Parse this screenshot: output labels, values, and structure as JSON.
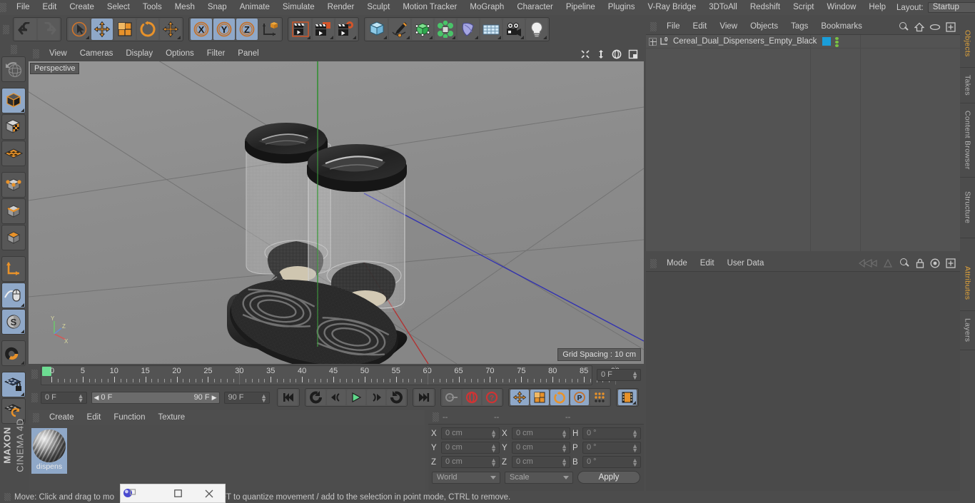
{
  "app": {
    "name": "MAXON CINEMA 4D",
    "brand_line1": "MAXON",
    "brand_line2": "CINEMA 4D"
  },
  "top_menu": {
    "items": [
      "File",
      "Edit",
      "Create",
      "Select",
      "Tools",
      "Mesh",
      "Snap",
      "Animate",
      "Simulate",
      "Render",
      "Sculpt",
      "Motion Tracker",
      "MoGraph",
      "Character",
      "Pipeline",
      "Plugins",
      "V-Ray Bridge",
      "3DToAll",
      "Redshift",
      "Script",
      "Window",
      "Help"
    ],
    "layout_label": "Layout:",
    "layout_value": "Startup",
    "search_icon": "search-icon"
  },
  "toolbar": {
    "groups": [
      {
        "name": "history",
        "buttons": [
          {
            "name": "undo-button",
            "icon": "undo-icon",
            "selected": false
          },
          {
            "name": "redo-button",
            "icon": "redo-icon",
            "selected": false
          }
        ]
      },
      {
        "name": "transform-tools",
        "buttons": [
          {
            "name": "live-selection-tool",
            "icon": "cursor-select-icon",
            "selected": false
          },
          {
            "name": "move-tool",
            "icon": "move-icon",
            "selected": true
          },
          {
            "name": "scale-tool",
            "icon": "scale-icon",
            "selected": false
          },
          {
            "name": "rotate-tool",
            "icon": "rotate-icon",
            "selected": false
          },
          {
            "name": "modeling-axis-tool",
            "icon": "move-icon",
            "selected": false
          }
        ]
      },
      {
        "name": "axis-locks",
        "buttons": [
          {
            "name": "lock-x-axis",
            "icon": "x-axis-icon",
            "label": "X",
            "selected": true
          },
          {
            "name": "lock-y-axis",
            "icon": "y-axis-icon",
            "label": "Y",
            "selected": true
          },
          {
            "name": "lock-z-axis",
            "icon": "z-axis-icon",
            "label": "Z",
            "selected": true
          },
          {
            "name": "world-object-coord-toggle",
            "icon": "world-coord-icon",
            "selected": false
          }
        ]
      },
      {
        "name": "render-tools",
        "buttons": [
          {
            "name": "render-view-button",
            "icon": "render-view-icon",
            "selected": false
          },
          {
            "name": "render-to-picture-viewer-button",
            "icon": "render-picture-icon",
            "selected": false
          },
          {
            "name": "render-settings-button",
            "icon": "render-settings-icon",
            "selected": false
          }
        ]
      },
      {
        "name": "create-objects",
        "buttons": [
          {
            "name": "add-cube-object",
            "icon": "cube-icon",
            "selected": false
          },
          {
            "name": "add-spline-object",
            "icon": "pen-spline-icon",
            "selected": false
          },
          {
            "name": "add-generator-object",
            "icon": "generator-cube-icon",
            "selected": false
          },
          {
            "name": "add-mograph-object",
            "icon": "mograph-cluster-icon",
            "selected": false
          },
          {
            "name": "add-deformer-object",
            "icon": "bend-deformer-icon",
            "selected": false
          },
          {
            "name": "add-environment-object",
            "icon": "floor-grid-icon",
            "selected": false
          },
          {
            "name": "add-camera-object",
            "icon": "camera-icon",
            "selected": false
          },
          {
            "name": "add-light-object",
            "icon": "light-bulb-icon",
            "selected": false
          }
        ]
      }
    ]
  },
  "left_toolbar": {
    "buttons": [
      {
        "name": "undo-view-button",
        "icon": "globe-undo-icon",
        "selected": false
      },
      {
        "name": "make-editable-button",
        "icon": "editable-cube-icon",
        "selected": true
      },
      {
        "name": "texture-axis-mode",
        "icon": "texture-cube-icon",
        "selected": false
      },
      {
        "name": "viewport-solo-mode",
        "icon": "grid-plane-icon",
        "selected": false
      },
      {
        "name": "point-mode",
        "icon": "point-mode-icon",
        "selected": false
      },
      {
        "name": "edge-mode",
        "icon": "edge-mode-icon",
        "selected": false
      },
      {
        "name": "polygon-mode",
        "icon": "polygon-mode-icon",
        "selected": false
      },
      {
        "name": "axis-modification",
        "icon": "axis-l-icon",
        "selected": false
      },
      {
        "name": "enable-snapping",
        "icon": "snap-mouse-icon",
        "selected": true
      },
      {
        "name": "workplane-mode",
        "icon": "workplane-s-icon",
        "selected": true
      },
      {
        "name": "magnet-tool",
        "icon": "magnet-icon",
        "selected": false
      },
      {
        "name": "lock-workplane",
        "icon": "workplane-lock-icon",
        "selected": true
      },
      {
        "name": "planar-workplane",
        "icon": "workplane-rotate-icon",
        "selected": false
      }
    ]
  },
  "viewport": {
    "menu_items": [
      "View",
      "Cameras",
      "Display",
      "Options",
      "Filter",
      "Panel"
    ],
    "label": "Perspective",
    "grid_spacing": "Grid Spacing : 10 cm",
    "axis_labels": {
      "x": "X",
      "y": "Y",
      "z": "Z"
    },
    "nav_icons": [
      "pan-icon",
      "dolly-icon",
      "orbit-icon",
      "maximize-view-icon"
    ]
  },
  "timeline": {
    "tick_labels": [
      "0",
      "5",
      "10",
      "15",
      "20",
      "25",
      "30",
      "35",
      "40",
      "45",
      "50",
      "55",
      "60",
      "65",
      "70",
      "75",
      "80",
      "85",
      "90"
    ],
    "tick_values": [
      0,
      5,
      10,
      15,
      20,
      25,
      30,
      35,
      40,
      45,
      50,
      55,
      60,
      65,
      70,
      75,
      80,
      85,
      90
    ],
    "range_start": 0,
    "range_end": 90,
    "current_frame_field": "0 F",
    "current_frame_small": "0 F",
    "preview_min": "0 F",
    "preview_max": "90 F",
    "max_frame_field": "90 F",
    "transport": [
      {
        "name": "go-to-start-button",
        "icon": "go-to-start-icon"
      },
      {
        "name": "play-backwards-loop-button",
        "icon": "loop-back-icon"
      },
      {
        "name": "previous-frame-button",
        "icon": "previous-frame-icon"
      },
      {
        "name": "play-forward-button",
        "icon": "play-icon"
      },
      {
        "name": "next-frame-button",
        "icon": "next-frame-icon"
      },
      {
        "name": "play-forward-loop-button",
        "icon": "loop-forward-icon"
      },
      {
        "name": "go-to-end-button",
        "icon": "go-to-end-icon"
      }
    ],
    "record_tools": [
      {
        "name": "autokeying-button",
        "icon": "key-icon",
        "selected": false
      },
      {
        "name": "record-active-objects-button",
        "icon": "record-icon",
        "selected": false
      },
      {
        "name": "keyframe-selection-button",
        "icon": "question-key-icon",
        "selected": false
      }
    ],
    "param_tools": [
      {
        "name": "record-position-button",
        "icon": "move-icon",
        "selected": true
      },
      {
        "name": "record-scale-button",
        "icon": "scale-icon",
        "selected": true
      },
      {
        "name": "record-rotation-button",
        "icon": "rotate-icon",
        "selected": true
      },
      {
        "name": "record-pla-button",
        "icon": "pla-icon",
        "selected": true
      },
      {
        "name": "record-points-button",
        "icon": "point-level-icon",
        "selected": false
      },
      {
        "name": "timeline-mode-button",
        "icon": "filmstrip-icon",
        "selected": true
      }
    ]
  },
  "material_manager": {
    "menu_items": [
      "Create",
      "Edit",
      "Function",
      "Texture"
    ],
    "materials": [
      {
        "name": "dispens",
        "selected": true,
        "icon": "material-sphere-icon"
      }
    ]
  },
  "coordinates": {
    "headers": [
      "--",
      "--",
      "--"
    ],
    "rows": [
      {
        "label_pos": "X",
        "value_pos": "0 cm",
        "label_size": "X",
        "value_size": "0 cm",
        "label_rot": "H",
        "value_rot": "0 °"
      },
      {
        "label_pos": "Y",
        "value_pos": "0 cm",
        "label_size": "Y",
        "value_size": "0 cm",
        "label_rot": "P",
        "value_rot": "0 °"
      },
      {
        "label_pos": "Z",
        "value_pos": "0 cm",
        "label_size": "Z",
        "value_size": "0 cm",
        "label_rot": "B",
        "value_rot": "0 °"
      }
    ],
    "system": "World",
    "mode": "Scale",
    "apply_label": "Apply"
  },
  "object_manager": {
    "menu_items": [
      "File",
      "Edit",
      "View",
      "Objects",
      "Tags",
      "Bookmarks"
    ],
    "icons": [
      "search-icon",
      "home-icon",
      "eye-icon",
      "expand-icon"
    ],
    "rows": [
      {
        "name": "Cereal_Dual_Dispensers_Empty_Black",
        "tag_color": "#1a9ed9",
        "has_children": true,
        "layer": "0"
      }
    ]
  },
  "attribute_manager": {
    "menu_items": [
      "Mode",
      "Edit",
      "User Data"
    ],
    "icons": [
      "history-back-icon",
      "history-forward-icon",
      "search-icon",
      "lock-icon",
      "target-icon",
      "expand-icon"
    ]
  },
  "dock_tabs": [
    {
      "label": "Objects",
      "active": true
    },
    {
      "label": "Takes",
      "active": false
    },
    {
      "label": "Content Browser",
      "active": false
    },
    {
      "label": "Structure",
      "active": false
    },
    {
      "label": "Attributes",
      "active": true
    },
    {
      "label": "Layers",
      "active": false
    }
  ],
  "status_bar": {
    "text_before": "Move: Click and drag to mo",
    "text_after": "FT to quantize movement / add to the selection in point mode, CTRL to remove.",
    "full_text": "Move: Click and drag to move the selection. SHIFT to quantize movement / add to the selection in point mode, CTRL to remove."
  },
  "mini_window": {
    "icon": "app-orb-icon",
    "maximize_label": "☐",
    "close_label": "✕"
  },
  "colors": {
    "accent_orange": "#e8922a",
    "selection_blue": "#8fa8c8",
    "tag_blue": "#1a9ed9",
    "green_marker": "#6ddc92",
    "panel_bg": "#4c4c4c",
    "viewport_bg": "#8b8b8b"
  }
}
